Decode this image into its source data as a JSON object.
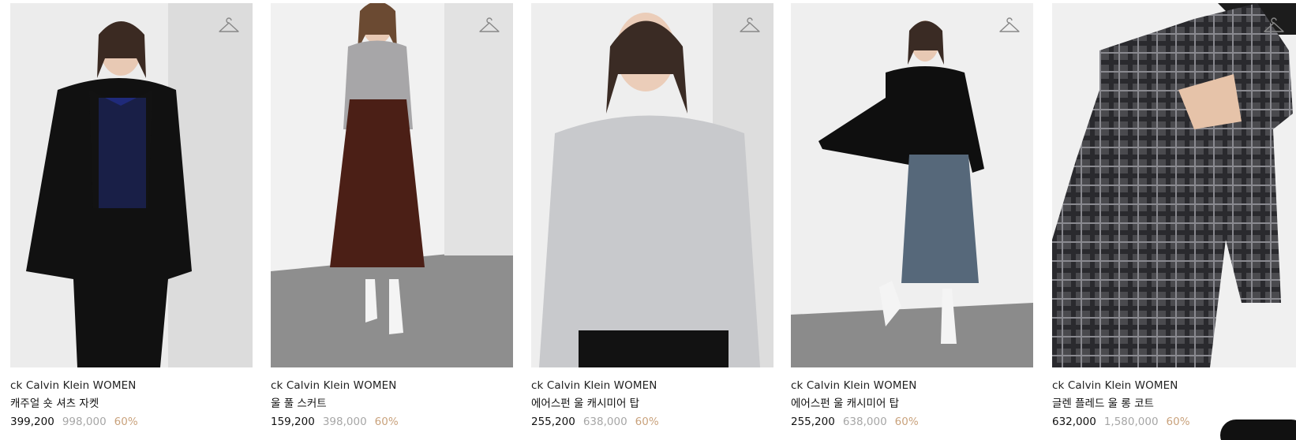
{
  "products": [
    {
      "brand": "ck Calvin Klein WOMEN",
      "name": "캐주얼 숏 셔츠 자켓",
      "price": "399,200",
      "original_price": "998,000",
      "discount": "60%",
      "image_desc": "woman in black short jacket over navy cardigan",
      "wishlist_icon": "hanger-icon"
    },
    {
      "brand": "ck Calvin Klein WOMEN",
      "name": "울 풀 스커트",
      "price": "159,200",
      "original_price": "398,000",
      "discount": "60%",
      "image_desc": "woman in grey turtleneck and brown wool flared skirt",
      "wishlist_icon": "hanger-icon"
    },
    {
      "brand": "ck Calvin Klein WOMEN",
      "name": "에어스펀 울 캐시미어 탑",
      "price": "255,200",
      "original_price": "638,000",
      "discount": "60%",
      "image_desc": "woman in light grey ribbed sweater",
      "wishlist_icon": "hanger-icon"
    },
    {
      "brand": "ck Calvin Klein WOMEN",
      "name": "에어스펀 울 캐시미어 탑",
      "price": "255,200",
      "original_price": "638,000",
      "discount": "60%",
      "image_desc": "woman in black sweater and blue velvet skirt",
      "wishlist_icon": "hanger-icon"
    },
    {
      "brand": "ck Calvin Klein WOMEN",
      "name": "글렌 플레드 울 롱 코트",
      "price": "632,000",
      "original_price": "1,580,000",
      "discount": "60%",
      "image_desc": "woman in grey glen plaid long coat",
      "wishlist_icon": "hanger-icon"
    }
  ],
  "colors": {
    "price": "#111111",
    "original_price": "#a6a6a6",
    "discount": "#c9a27c",
    "background": "#ffffff"
  }
}
